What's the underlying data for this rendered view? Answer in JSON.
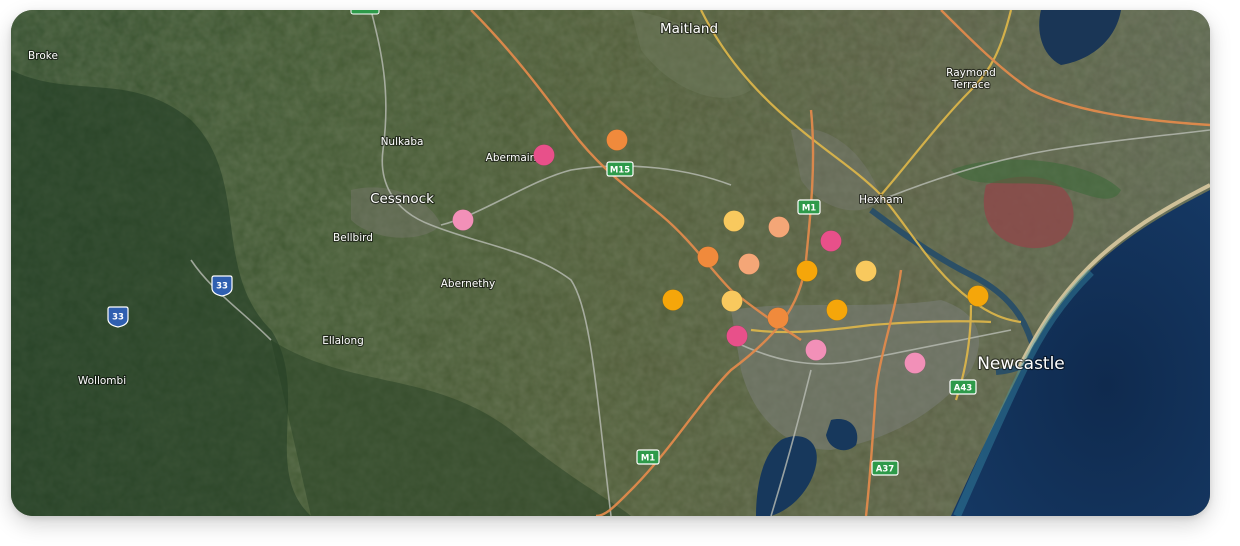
{
  "map": {
    "places": {
      "maitland": "Maitland",
      "broke": "Broke",
      "raymond_terrace": "Raymond\nTerrace",
      "nulkaba": "Nulkaba",
      "abermain": "Abermain",
      "cessnock": "Cessnock",
      "bellbird": "Bellbird",
      "hexham": "Hexham",
      "abernethy": "Abernethy",
      "ellalong": "Ellalong",
      "wollombi": "Wollombi",
      "newcastle": "Newcastle"
    },
    "route_shields": {
      "m15": "M15",
      "m1_north": "M1",
      "m1_south": "M1",
      "r33_a": "33",
      "r33_b": "33",
      "a43": "A43",
      "a37": "A37"
    },
    "marker_colors": {
      "magenta": "#e8508a",
      "pink": "#f290b8",
      "orange": "#f08a3c",
      "amber": "#f5a60a",
      "yellow": "#f8c95e",
      "peach": "#f4a677"
    },
    "markers": [
      "magenta",
      "orange",
      "pink",
      "yellow",
      "peach",
      "magenta",
      "orange",
      "peach",
      "amber",
      "yellow",
      "amber",
      "yellow",
      "orange",
      "amber",
      "magenta",
      "pink",
      "pink",
      "amber"
    ]
  }
}
